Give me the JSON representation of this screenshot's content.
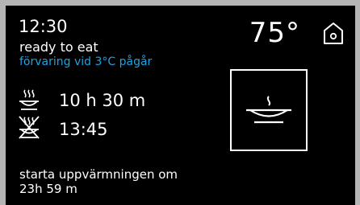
{
  "screen": {
    "time": "12:30",
    "status": "ready to eat",
    "storage_text": "förvaring vid 3°C pågår",
    "temperature": "75°",
    "program_duration": "10 h 30 m",
    "end_time": "13:45",
    "delay_label": "starta uppvärmningen om",
    "delay_value": "23h 59 m"
  },
  "icons": {
    "home": "home-icon",
    "duration": "dish-steam-icon",
    "end_time": "no-heating-crossed-icon",
    "dish_button": "warm-dish-icon"
  },
  "colors": {
    "background": "#000000",
    "text": "#ffffff",
    "accent": "#1fa3e0",
    "frame": "#b5b5b5"
  }
}
